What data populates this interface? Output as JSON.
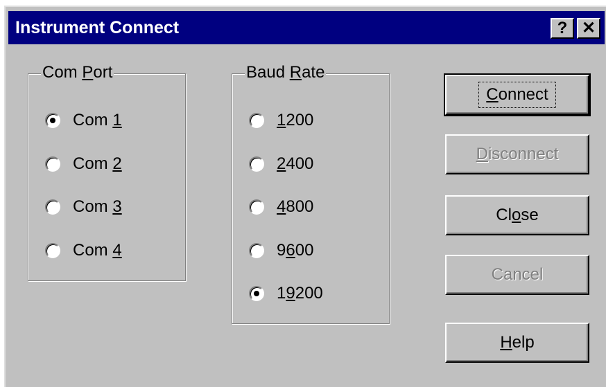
{
  "window": {
    "title": "Instrument Connect",
    "help_glyph": "?",
    "close_glyph": "✕"
  },
  "com_port": {
    "legend_pre": "Com ",
    "legend_accel": "P",
    "legend_post": "ort",
    "options": [
      {
        "pre": "Com ",
        "accel": "1",
        "post": "",
        "checked": true
      },
      {
        "pre": "Com ",
        "accel": "2",
        "post": "",
        "checked": false
      },
      {
        "pre": "Com ",
        "accel": "3",
        "post": "",
        "checked": false
      },
      {
        "pre": "Com ",
        "accel": "4",
        "post": "",
        "checked": false
      }
    ]
  },
  "baud_rate": {
    "legend_pre": "Baud ",
    "legend_accel": "R",
    "legend_post": "ate",
    "options": [
      {
        "pre": "",
        "accel": "1",
        "post": "200",
        "checked": false
      },
      {
        "pre": "",
        "accel": "2",
        "post": "400",
        "checked": false
      },
      {
        "pre": "",
        "accel": "4",
        "post": "800",
        "checked": false
      },
      {
        "pre": "9",
        "accel": "6",
        "post": "00",
        "checked": false
      },
      {
        "pre": "1",
        "accel": "9",
        "post": "200",
        "checked": true
      }
    ]
  },
  "buttons": {
    "connect": {
      "accel": "C",
      "rest": "onnect",
      "enabled": true
    },
    "disconnect": {
      "accel": "D",
      "rest": "isconnect",
      "enabled": false
    },
    "close": {
      "pre": "Cl",
      "accel": "o",
      "rest": "se",
      "enabled": true
    },
    "cancel": {
      "label": "Cancel",
      "enabled": false
    },
    "help": {
      "accel": "H",
      "rest": "elp",
      "enabled": true
    }
  }
}
